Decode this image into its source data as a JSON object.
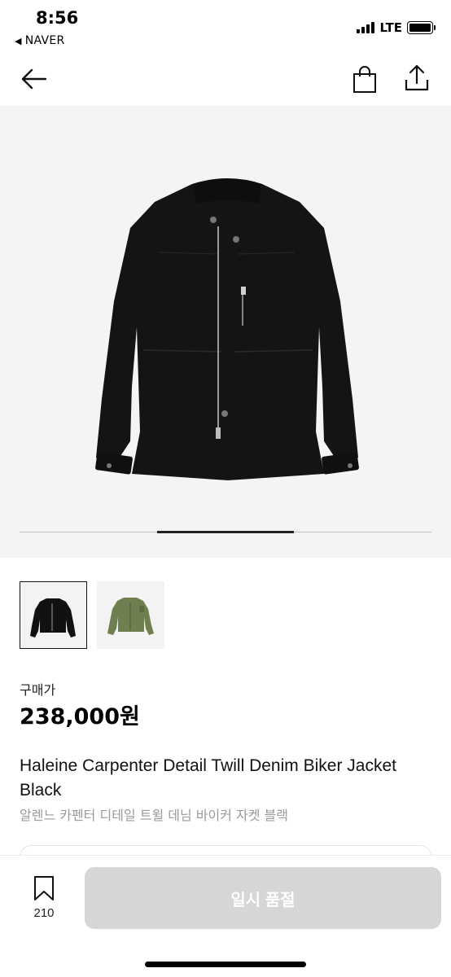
{
  "status_bar": {
    "time": "8:56",
    "back_app": "NAVER",
    "network": "LTE",
    "back_glyph": "◀"
  },
  "header": {
    "back_icon": "arrow-left-icon",
    "cart_icon": "shopping-bag-icon",
    "share_icon": "share-icon"
  },
  "gallery": {
    "background": "#f4f4f4",
    "thumbnails": [
      {
        "name": "black",
        "color": "#111111"
      },
      {
        "name": "khaki",
        "color": "#6f7f4f"
      }
    ]
  },
  "price": {
    "label": "구매가",
    "value": "238,000원"
  },
  "product": {
    "title_en": "Haleine Carpenter Detail Twill Denim Biker Jacket Black",
    "title_ko": "알렌느 카펜터 디테일 트윌 데님 바이커 자켓 블랙"
  },
  "bottom_bar": {
    "bookmark_count": "210",
    "cta_label": "일시 품절",
    "cta_color": "#d6d6d6"
  }
}
